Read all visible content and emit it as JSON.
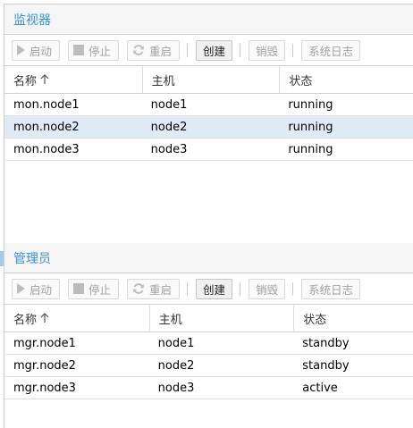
{
  "monitors": {
    "title": "监视器",
    "toolbar": {
      "start": "启动",
      "stop": "停止",
      "restart": "重启",
      "create": "创建",
      "destroy": "销毁",
      "syslog": "系统日志"
    },
    "columns": [
      "名称",
      "主机",
      "状态"
    ],
    "rows": [
      {
        "name": "mon.node1",
        "host": "node1",
        "status": "running"
      },
      {
        "name": "mon.node2",
        "host": "node2",
        "status": "running"
      },
      {
        "name": "mon.node3",
        "host": "node3",
        "status": "running"
      }
    ]
  },
  "managers": {
    "title": "管理员",
    "toolbar": {
      "start": "启动",
      "stop": "停止",
      "restart": "重启",
      "create": "创建",
      "destroy": "销毁",
      "syslog": "系统日志"
    },
    "columns": [
      "名称",
      "主机",
      "状态"
    ],
    "rows": [
      {
        "name": "mgr.node1",
        "host": "node1",
        "status": "standby"
      },
      {
        "name": "mgr.node2",
        "host": "node2",
        "status": "standby"
      },
      {
        "name": "mgr.node3",
        "host": "node3",
        "status": "active"
      }
    ]
  },
  "colors": {
    "accent": "#3892d4",
    "selected_row": "#dfeaf5",
    "disabled_text": "#a0a0a0"
  }
}
